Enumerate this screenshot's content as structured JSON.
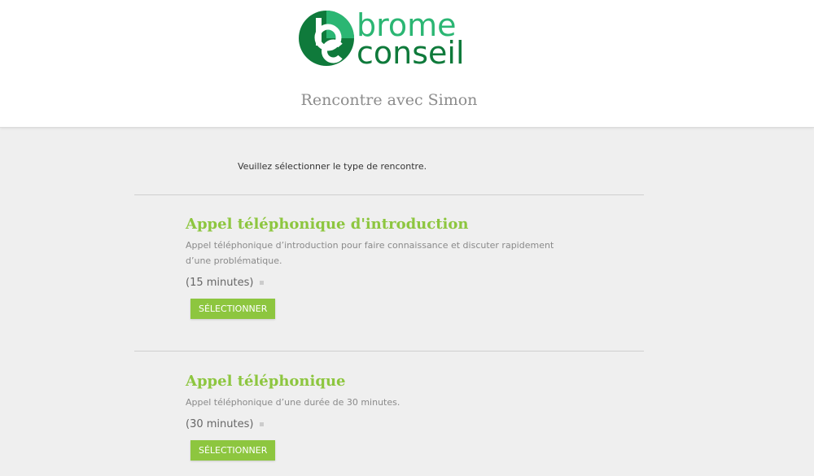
{
  "header": {
    "logo": {
      "line1": "brome",
      "line2": "conseil",
      "colors": {
        "light": "#2bb673",
        "dark": "#0f7a3b"
      }
    },
    "title": "Rencontre avec Simon"
  },
  "main": {
    "instruction": "Veuillez sélectionner le type de rencontre.",
    "meetings": [
      {
        "title": "Appel téléphonique d'introduction",
        "description": "Appel téléphonique d’introduction pour faire connaissance et discuter rapidement d’une problématique.",
        "duration": "(15 minutes)",
        "button_label": "SÉLECTIONNER"
      },
      {
        "title": "Appel téléphonique",
        "description": "Appel téléphonique d’une durée de 30 minutes.",
        "duration": "(30 minutes)",
        "button_label": "SÉLECTIONNER"
      }
    ]
  },
  "colors": {
    "accent": "#8dc63f",
    "background": "#efefef"
  }
}
